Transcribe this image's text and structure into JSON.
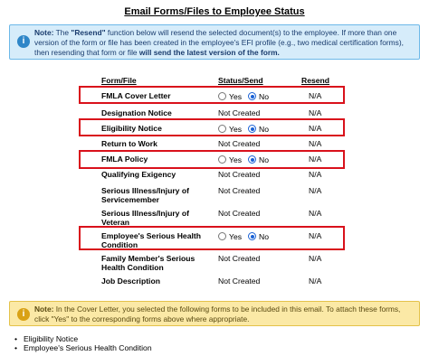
{
  "page_title": "Email Forms/Files to Employee Status",
  "info_note": {
    "label": "Note:",
    "text_1": " The ",
    "resend_word": "\"Resend\"",
    "text_2": " function below will resend the selected document(s) to the employee. If more than one version of the form or file has been created in the employee's EFI profile (e.g., two medical certification forms), then resending that form or file ",
    "emphasis": "will send the latest version of the form."
  },
  "columns": {
    "form": "Form/File",
    "status": "Status/Send",
    "resend": "Resend"
  },
  "radio_labels": {
    "yes": "Yes",
    "no": "No"
  },
  "rows": [
    {
      "name": "FMLA Cover Letter",
      "type": "radio",
      "selected": "no",
      "resend": "N/A",
      "highlighted": true
    },
    {
      "name": "Designation Notice",
      "type": "text",
      "status": "Not Created",
      "resend": "N/A",
      "highlighted": false
    },
    {
      "name": "Eligibility Notice",
      "type": "radio",
      "selected": "no",
      "resend": "N/A",
      "highlighted": true
    },
    {
      "name": "Return to Work",
      "type": "text",
      "status": "Not Created",
      "resend": "N/A",
      "highlighted": false
    },
    {
      "name": "FMLA Policy",
      "type": "radio",
      "selected": "no",
      "resend": "N/A",
      "highlighted": true
    },
    {
      "name": "Qualifying Exigency",
      "type": "text",
      "status": "Not Created",
      "resend": "N/A",
      "highlighted": false
    },
    {
      "name": "Serious Illness/Injury of Servicemember",
      "type": "text",
      "status": "Not Created",
      "resend": "N/A",
      "highlighted": false
    },
    {
      "name": "Serious Illness/Injury of Veteran",
      "type": "text",
      "status": "Not Created",
      "resend": "N/A",
      "highlighted": false
    },
    {
      "name": "Employee's Serious Health Condition",
      "type": "radio",
      "selected": "no",
      "resend": "N/A",
      "highlighted": true
    },
    {
      "name": "Family Member's Serious Health Condition",
      "type": "text",
      "status": "Not Created",
      "resend": "N/A",
      "highlighted": false
    },
    {
      "name": "Job Description",
      "type": "text",
      "status": "Not Created",
      "resend": "N/A",
      "highlighted": false
    }
  ],
  "warn_note": {
    "label": "Note:",
    "text": " In the Cover Letter, you selected the following forms to be included in this email. To attach these forms, click \"Yes\" to the corresponding forms above where appropriate."
  },
  "selected_forms": [
    "Eligibility Notice",
    "Employee's Serious Health Condition"
  ],
  "colors": {
    "highlight": "#d9111b",
    "info_bg": "#d6ecfa",
    "warn_bg": "#fbe9a6"
  },
  "icons": {
    "info": "info-circle-icon",
    "warning": "info-circle-icon"
  }
}
